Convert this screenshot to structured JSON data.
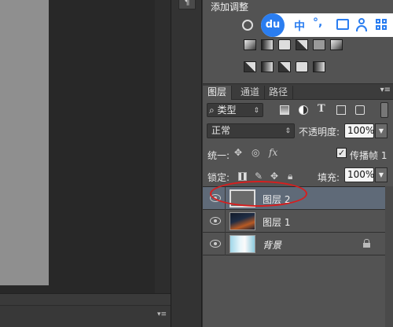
{
  "adjustments": {
    "title": "添加调整"
  },
  "ime_toolbar": {
    "logo": "du",
    "lang_label": "中",
    "punct_label": "°,"
  },
  "layers_panel": {
    "tabs": [
      {
        "label": "图层",
        "active": true
      },
      {
        "label": "通道",
        "active": false
      },
      {
        "label": "路径",
        "active": false
      }
    ],
    "filter": {
      "icon": "search-icon",
      "label": "类型",
      "arrow": "⇕"
    },
    "blend_mode": {
      "value": "正常",
      "arrow": "⇕"
    },
    "opacity": {
      "label": "不透明度:",
      "value": "100%"
    },
    "unify_label": "统一:",
    "propagate": {
      "label": "传播帧 1",
      "checked": true
    },
    "lock_label": "锁定:",
    "fill": {
      "label": "填充:",
      "value": "100%"
    },
    "layers": [
      {
        "name": "图层 2",
        "selected": true,
        "visible": true
      },
      {
        "name": "图层 1",
        "selected": false,
        "visible": true
      },
      {
        "name": "背景",
        "selected": false,
        "visible": true,
        "locked": true
      }
    ]
  },
  "colors": {
    "panel_bg": "#535353",
    "selection": "#5f6a78",
    "ime_blue": "#2a7df0",
    "annotation_red": "#d81e1e"
  }
}
